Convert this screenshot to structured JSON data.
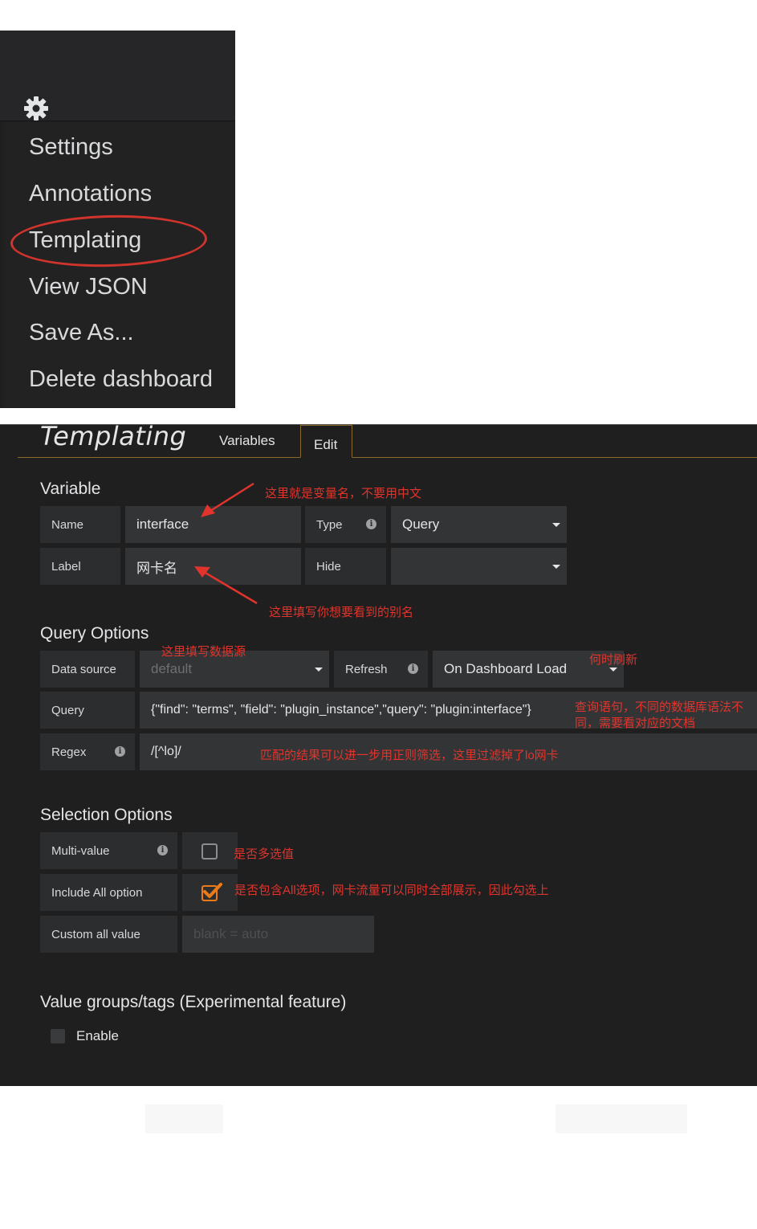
{
  "menu": {
    "items": [
      "Settings",
      "Annotations",
      "Templating",
      "View JSON",
      "Save As...",
      "Delete dashboard"
    ]
  },
  "panel": {
    "title": "Templating",
    "tabs": {
      "variables": "Variables",
      "edit": "Edit"
    },
    "variable": {
      "section_title": "Variable",
      "name_label": "Name",
      "name_value": "interface",
      "type_label": "Type",
      "type_value": "Query",
      "label_label": "Label",
      "label_value": "网卡名",
      "hide_label": "Hide",
      "hide_value": ""
    },
    "query_options": {
      "section_title": "Query Options",
      "datasource_label": "Data source",
      "datasource_value": "default",
      "refresh_label": "Refresh",
      "refresh_value": "On Dashboard Load",
      "query_label": "Query",
      "query_value": "{\"find\": \"terms\", \"field\": \"plugin_instance\",\"query\": \"plugin:interface\"}",
      "regex_label": "Regex",
      "regex_value": "/[^lo]/"
    },
    "selection_options": {
      "section_title": "Selection Options",
      "multi_label": "Multi-value",
      "multi_checked": false,
      "include_all_label": "Include All option",
      "include_all_checked": true,
      "custom_all_label": "Custom all value",
      "custom_all_placeholder": "blank = auto"
    },
    "value_groups": {
      "section_title": "Value groups/tags (Experimental feature)",
      "enable_label": "Enable"
    }
  },
  "annotations": {
    "name_note": "这里就是变量名，不要用中文",
    "label_note": "这里填写你想要看到的别名",
    "datasource_note": "这里填写数据源",
    "refresh_note": "何时刷新",
    "query_note_1": "查询语句，不同的数据库语法不",
    "query_note_2": "同，需要看对应的文档",
    "regex_note": "匹配的结果可以进一步用正则筛选，这里过滤掉了lo网卡",
    "multi_note": "是否多选值",
    "include_all_note": "是否包含All选项，网卡流量可以同时全部展示，因此勾选上"
  },
  "colors": {
    "annotation_red": "#e0342c",
    "accent_orange": "#eb7b18",
    "panel_bg": "#1f1f20"
  }
}
